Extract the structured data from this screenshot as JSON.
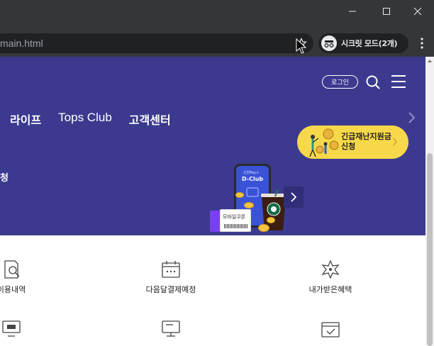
{
  "browser": {
    "url": "main.html",
    "incognito_label": "시크릿 모드(2개)",
    "window_controls": [
      "minimize-icon",
      "maximize-icon",
      "close-icon"
    ]
  },
  "header": {
    "login_label": "로그인"
  },
  "nav": {
    "items": [
      "라이프",
      "Tops Club",
      "고객센터"
    ]
  },
  "promo_pill": {
    "line1": "긴급재난지원금",
    "line2": "신청"
  },
  "hero": {
    "title_fragment": "청",
    "phone_small": "신한Pay+",
    "phone_brand": "D-Club",
    "coupon_label": "모바일쿠폰"
  },
  "services": {
    "row1": [
      "이용내역",
      "다음달결제예정",
      "내가받은혜택"
    ],
    "row1_icons": [
      "document-search-icon",
      "calendar-dots-icon",
      "gift-burst-icon"
    ]
  },
  "colors": {
    "hero_bg": "#3b3a8f",
    "pill_bg": "#f7d84a",
    "chrome_bg": "#35363a"
  }
}
